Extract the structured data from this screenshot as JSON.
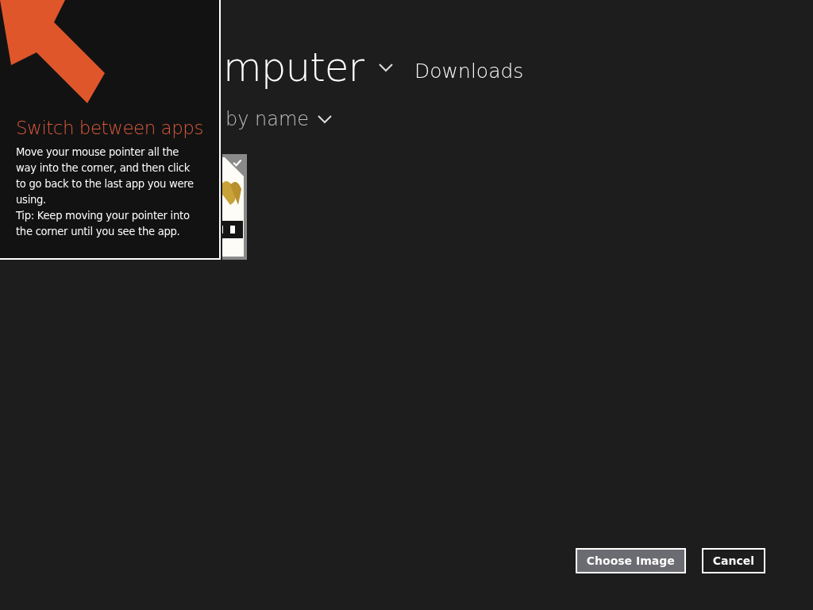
{
  "header": {
    "location": "mputer",
    "folder": "Downloads"
  },
  "sort": {
    "label": "by name"
  },
  "files": [
    {
      "kind": "picture",
      "selected": true
    }
  ],
  "buttons": [
    {
      "label": "Choose Image",
      "kind": "primary"
    },
    {
      "label": "Cancel",
      "kind": "secondary"
    }
  ],
  "tip": {
    "title": "Switch between apps",
    "body": "Move your mouse pointer all the way into the corner, and then click to go back to the last app you were using.\nTip: Keep moving your pointer into the corner until you see the app."
  }
}
